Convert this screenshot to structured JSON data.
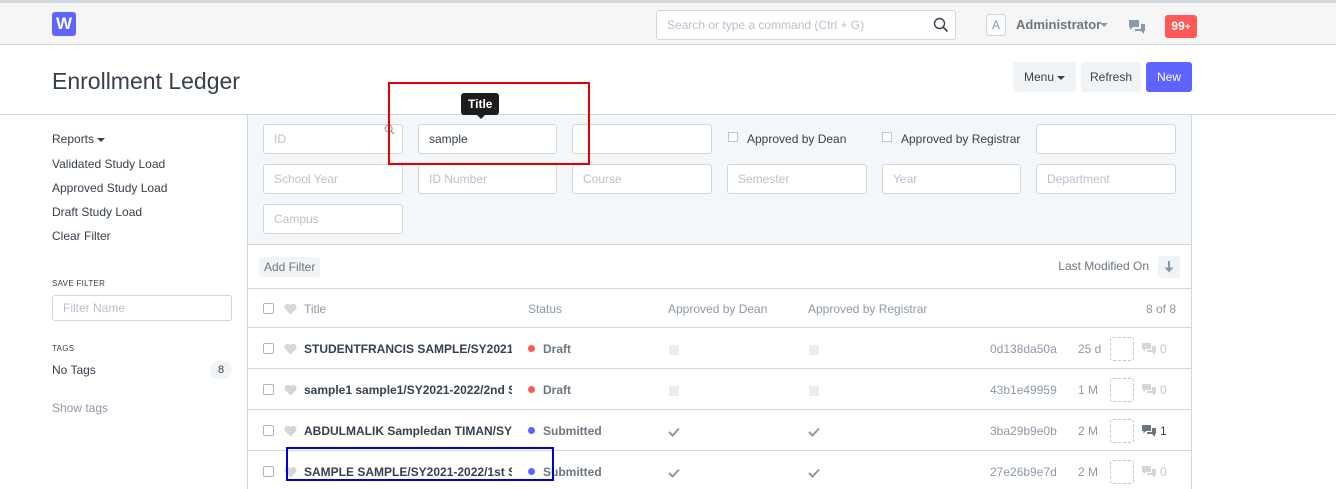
{
  "navbar": {
    "logo_letter": "W",
    "search_placeholder": "Search or type a command (Ctrl + G)",
    "avatar_letter": "A",
    "user_name": "Administrator",
    "notifications": "99",
    "notifications_suffix": "+"
  },
  "page": {
    "title": "Enrollment Ledger",
    "menu_label": "Menu",
    "refresh_label": "Refresh",
    "new_label": "New"
  },
  "sidebar": {
    "reports_label": "Reports",
    "links": [
      "Validated Study Load",
      "Approved Study Load",
      "Draft Study Load",
      "Clear Filter"
    ],
    "save_filter_heading": "SAVE FILTER",
    "filter_name_placeholder": "Filter Name",
    "tags_heading": "TAGS",
    "no_tags_label": "No Tags",
    "no_tags_count": "8",
    "show_tags_label": "Show tags"
  },
  "filters": {
    "id_placeholder": "ID",
    "title_value": "sample",
    "title_tooltip": "Title",
    "empty_value": "",
    "approved_dean_label": "Approved by Dean",
    "approved_registrar_label": "Approved by Registrar",
    "school_year_placeholder": "School Year",
    "id_number_placeholder": "ID Number",
    "course_placeholder": "Course",
    "semester_placeholder": "Semester",
    "year_placeholder": "Year",
    "department_placeholder": "Department",
    "campus_placeholder": "Campus",
    "add_filter_label": "Add Filter",
    "sort_label": "Last Modified On"
  },
  "list": {
    "columns": {
      "title": "Title",
      "status": "Status",
      "approved_dean": "Approved by Dean",
      "approved_registrar": "Approved by Registrar",
      "count": "8 of 8"
    },
    "status_colors": {
      "Draft": "#ff5858",
      "Submitted": "#5e64ff"
    },
    "rows": [
      {
        "title": "STUDENTFRANCIS SAMPLE/SY2021-2",
        "status": "Draft",
        "dean": "unchecked",
        "registrar": "unchecked",
        "name": "0d138da50a",
        "age": "25 d",
        "comments": "0"
      },
      {
        "title": "sample1 sample1/SY2021-2022/2nd S",
        "status": "Draft",
        "dean": "unchecked",
        "registrar": "unchecked",
        "name": "43b1e49959",
        "age": "1 M",
        "comments": "0"
      },
      {
        "title": "ABDULMALIK Sampledan TIMAN/SY2",
        "status": "Submitted",
        "dean": "checked",
        "registrar": "checked",
        "name": "3ba29b9e0b",
        "age": "2 M",
        "comments": "1"
      },
      {
        "title": "SAMPLE SAMPLE/SY2021-2022/1st Se",
        "status": "Submitted",
        "dean": "checked",
        "registrar": "checked",
        "name": "27e26b9e7d",
        "age": "2 M",
        "comments": "0"
      }
    ]
  }
}
